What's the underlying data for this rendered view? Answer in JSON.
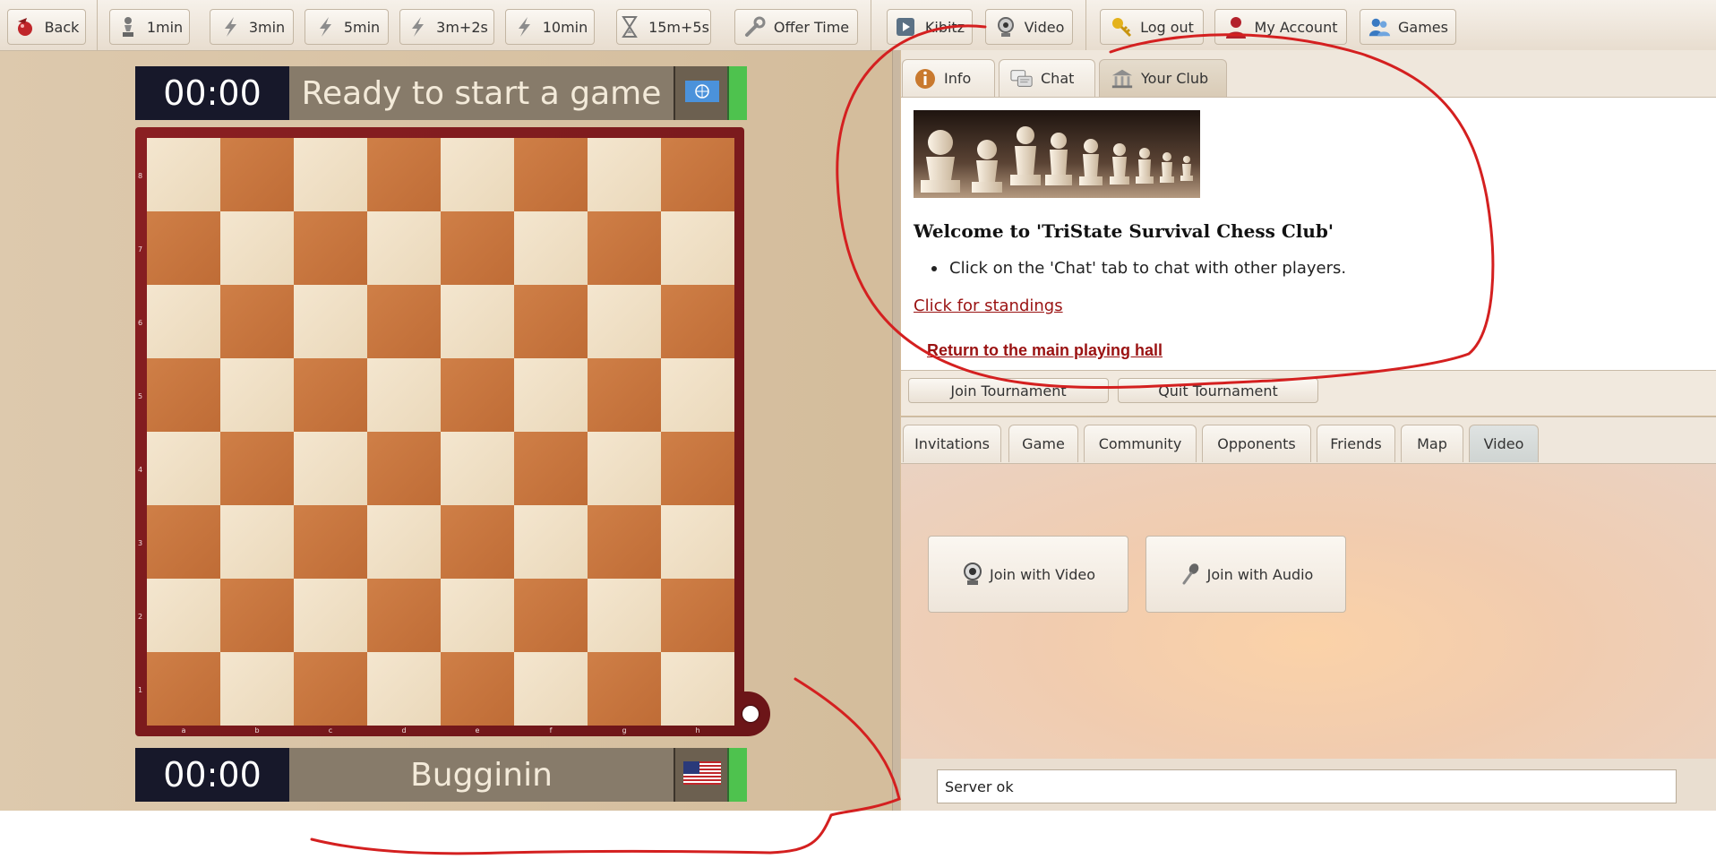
{
  "toolbar": {
    "buttons": [
      {
        "label": "Back",
        "icon": "back-arrow-icon"
      },
      {
        "label": "1min",
        "icon": "pawn-icon"
      },
      {
        "label": "3min",
        "icon": "lightning-icon"
      },
      {
        "label": "5min",
        "icon": "lightning-icon"
      },
      {
        "label": "3m+2s",
        "icon": "lightning-icon"
      },
      {
        "label": "10min",
        "icon": "lightning-icon"
      },
      {
        "label": "15m+5s",
        "icon": "hourglass-icon"
      },
      {
        "label": "Offer Time",
        "icon": "wrench-icon"
      },
      {
        "label": "Kibitz",
        "icon": "play-icon"
      },
      {
        "label": "Video",
        "icon": "webcam-icon"
      },
      {
        "label": "Log out",
        "icon": "key-icon"
      },
      {
        "label": "My Account",
        "icon": "user-icon"
      },
      {
        "label": "Games",
        "icon": "users-icon"
      }
    ]
  },
  "top_player": {
    "clock": "00:00",
    "name": "Ready to start a game",
    "flag": "un-flag-icon"
  },
  "bottom_player": {
    "clock": "00:00",
    "name": "Bugginin",
    "flag": "us-flag-icon"
  },
  "board": {
    "ranks": [
      "8",
      "7",
      "6",
      "5",
      "4",
      "3",
      "2",
      "1"
    ],
    "files": [
      "a",
      "b",
      "c",
      "d",
      "e",
      "f",
      "g",
      "h"
    ]
  },
  "panel_tabs": [
    {
      "label": "Info",
      "icon": "info-icon"
    },
    {
      "label": "Chat",
      "icon": "chat-icon"
    },
    {
      "label": "Your Club",
      "icon": "club-building-icon",
      "active": true
    }
  ],
  "club": {
    "welcome": "Welcome to 'TriState Survival Chess Club'",
    "bullet": "Click on the 'Chat' tab to chat with other players.",
    "standings_link": "Click for standings",
    "return_link": "Return to the main playing hall",
    "join_tournament": "Join Tournament",
    "quit_tournament": "Quit Tournament"
  },
  "lower_tabs": [
    {
      "label": "Invitations"
    },
    {
      "label": "Game"
    },
    {
      "label": "Community"
    },
    {
      "label": "Opponents"
    },
    {
      "label": "Friends"
    },
    {
      "label": "Map"
    },
    {
      "label": "Video",
      "active": true
    }
  ],
  "video": {
    "join_video": "Join with Video",
    "join_audio": "Join with Audio"
  },
  "status": {
    "text": "Server ok"
  },
  "colors": {
    "annotation": "#d42020",
    "clock_bg": "#17182a",
    "link": "#9a1212",
    "indicator": "#4ec24e"
  }
}
